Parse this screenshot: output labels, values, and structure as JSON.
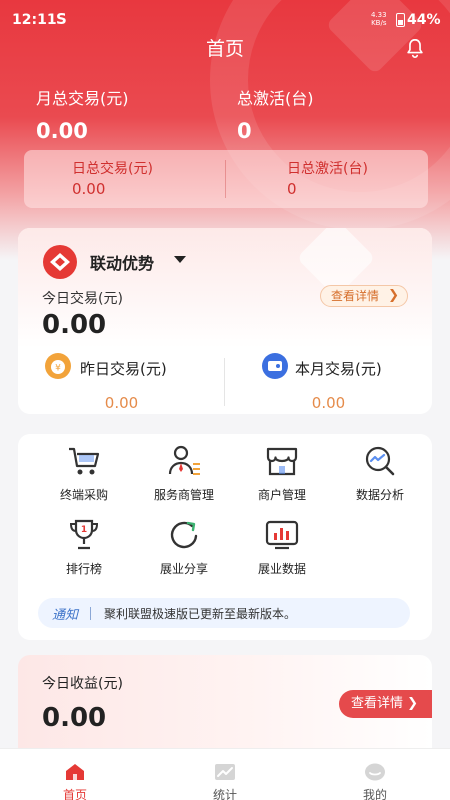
{
  "status_bar": {
    "time": "12:11",
    "app_icon": "S",
    "net_speed": "4.33",
    "net_unit": "KB/s",
    "battery": "44%"
  },
  "header": {
    "title": "首页"
  },
  "summary": {
    "monthly_label": "月总交易(元)",
    "monthly_value": "0.00",
    "activation_label": "总激活(台)",
    "activation_value": "0"
  },
  "daily": {
    "trade_label": "日总交易(元)",
    "trade_value": "0.00",
    "activation_label": "日总激活(台)",
    "activation_value": "0"
  },
  "brand_card": {
    "brand_name": "联动优势",
    "today_label": "今日交易(元)",
    "today_value": "0.00",
    "detail_label": "查看详情",
    "yesterday_label": "昨日交易(元)",
    "yesterday_value": "0.00",
    "month_label": "本月交易(元)",
    "month_value": "0.00"
  },
  "grid": [
    {
      "label": "终端采购",
      "icon": "cart-icon"
    },
    {
      "label": "服务商管理",
      "icon": "person-icon"
    },
    {
      "label": "商户管理",
      "icon": "store-icon"
    },
    {
      "label": "数据分析",
      "icon": "analytics-icon"
    },
    {
      "label": "排行榜",
      "icon": "trophy-icon"
    },
    {
      "label": "展业分享",
      "icon": "share-icon"
    },
    {
      "label": "展业数据",
      "icon": "chart-icon"
    }
  ],
  "notice": {
    "tag": "通知",
    "message": "聚利联盟极速版已更新至最新版本。"
  },
  "earnings": {
    "label": "今日收益(元)",
    "value": "0.00",
    "detail_label": "查看详情"
  },
  "tabbar": [
    {
      "label": "首页",
      "icon": "home-icon",
      "active": true
    },
    {
      "label": "统计",
      "icon": "stats-icon",
      "active": false
    },
    {
      "label": "我的",
      "icon": "profile-icon",
      "active": false
    }
  ],
  "colors": {
    "primary": "#e53935",
    "accent_orange": "#e58b4a",
    "notice_blue": "#3d73c9"
  }
}
